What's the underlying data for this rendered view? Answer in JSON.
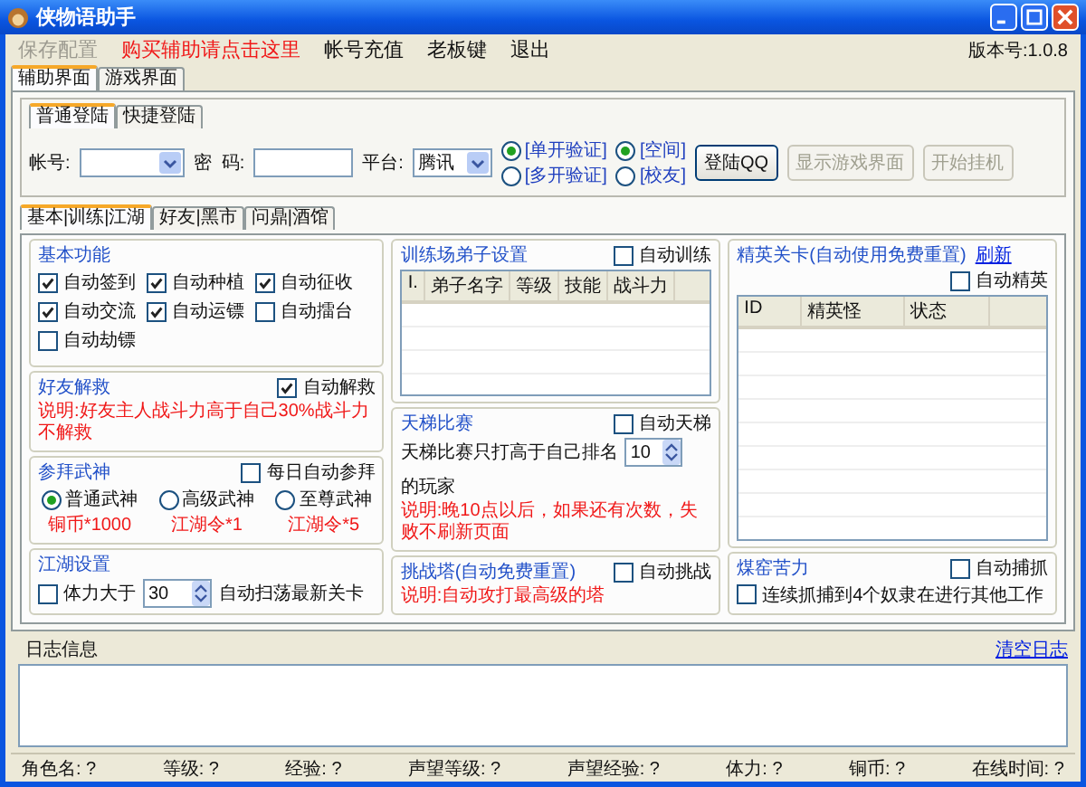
{
  "window": {
    "title": "侠物语助手"
  },
  "menu": [
    {
      "label": "保存配置",
      "kind": "disabled"
    },
    {
      "label": "购买辅助请点击这里",
      "kind": "promo"
    },
    {
      "label": "帐号充值",
      "kind": "normal"
    },
    {
      "label": "老板键",
      "kind": "normal"
    },
    {
      "label": "退出",
      "kind": "normal"
    }
  ],
  "version": "版本号:1.0.8",
  "main_tabs": [
    {
      "label": "辅助界面",
      "selected": true
    },
    {
      "label": "游戏界面",
      "selected": false
    }
  ],
  "login": {
    "tabs": [
      {
        "label": "普通登陆",
        "selected": true
      },
      {
        "label": "快捷登陆",
        "selected": false
      }
    ],
    "account_label": "帐号:",
    "password_label": "密  码:",
    "platform_label": "平台:",
    "platform_value": "腾讯",
    "verify_options": [
      {
        "label": "[单开验证]",
        "selected": true
      },
      {
        "label": "[多开验证]",
        "selected": false
      }
    ],
    "zone_options": [
      {
        "label": "[空间]",
        "selected": true
      },
      {
        "label": "[校友]",
        "selected": false
      }
    ],
    "buttons": [
      {
        "label": "登陆QQ",
        "disabled": false
      },
      {
        "label": "显示游戏界面",
        "disabled": true
      },
      {
        "label": "开始挂机",
        "disabled": true
      }
    ]
  },
  "sub_tabs": [
    {
      "label": "基本|训练|江湖",
      "selected": true
    },
    {
      "label": "好友|黑市",
      "selected": false
    },
    {
      "label": "问鼎|酒馆",
      "selected": false
    }
  ],
  "basic": {
    "title": "基本功能",
    "checks": [
      {
        "label": "自动签到",
        "checked": true
      },
      {
        "label": "自动种植",
        "checked": true
      },
      {
        "label": "自动征收",
        "checked": true
      },
      {
        "label": "自动交流",
        "checked": true
      },
      {
        "label": "自动运镖",
        "checked": true
      },
      {
        "label": "自动擂台",
        "checked": false
      },
      {
        "label": "自动劫镖",
        "checked": false
      }
    ]
  },
  "friend_rescue": {
    "title": "好友解救",
    "toggle": {
      "label": "自动解救",
      "checked": true
    },
    "note": "说明:好友主人战斗力高于自己30%战斗力不解救"
  },
  "worship": {
    "title": "参拜武神",
    "toggle": {
      "label": "每日自动参拜",
      "checked": false
    },
    "options": [
      {
        "label": "普通武神",
        "cost": "铜币*1000",
        "selected": true
      },
      {
        "label": "高级武神",
        "cost": "江湖令*1",
        "selected": false
      },
      {
        "label": "至尊武神",
        "cost": "江湖令*5",
        "selected": false
      }
    ]
  },
  "jianghu": {
    "title": "江湖设置",
    "stamina": {
      "label": "体力大于",
      "checked": false,
      "value": "30",
      "suffix": "自动扫荡最新关卡"
    }
  },
  "training": {
    "title": "训练场弟子设置",
    "toggle": {
      "label": "自动训练",
      "checked": false
    },
    "columns": [
      "I.",
      "弟子名字",
      "等级",
      "技能",
      "战斗力"
    ]
  },
  "ladder": {
    "title": "天梯比赛",
    "toggle": {
      "label": "自动天梯",
      "checked": false
    },
    "prefix": "天梯比赛只打高于自己排名",
    "value": "10",
    "suffix": "的玩家",
    "note": "说明:晚10点以后，如果还有次数，失败不刷新页面"
  },
  "tower": {
    "title": "挑战塔(自动免费重置)",
    "toggle": {
      "label": "自动挑战",
      "checked": false
    },
    "note": "说明:自动攻打最高级的塔"
  },
  "elite": {
    "title": "精英关卡(自动使用免费重置)",
    "link": "刷新",
    "toggle": {
      "label": "自动精英",
      "checked": false
    },
    "columns": [
      "ID",
      "精英怪",
      "状态"
    ]
  },
  "slaves": {
    "title": "煤窑苦力",
    "toggle": {
      "label": "自动捕抓",
      "checked": false
    },
    "check": {
      "label": "连续抓捕到4个奴隶在进行其他工作",
      "checked": false
    }
  },
  "log": {
    "title": "日志信息",
    "clear_link": "清空日志"
  },
  "status_bar": [
    "角色名: ?",
    "等级: ?",
    "经验: ?",
    "声望等级: ?",
    "声望经验: ?",
    "体力: ?",
    "铜币: ?",
    "在线时间: ?"
  ]
}
